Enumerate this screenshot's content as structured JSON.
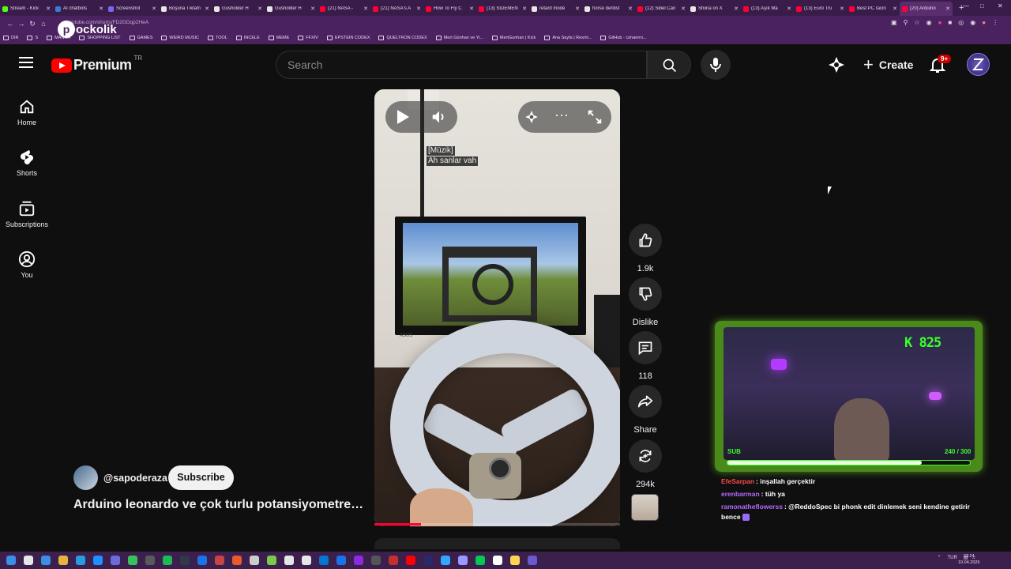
{
  "browser": {
    "tabs": [
      {
        "title": "Stream - Kick",
        "color": "#53fc18",
        "active": false
      },
      {
        "title": "AI chatbots",
        "color": "#3a7bd5",
        "active": false
      },
      {
        "title": "Screenshot",
        "color": "#7b68ee",
        "active": false
      },
      {
        "title": "Boşuna Tıklam",
        "color": "#e6e6e6",
        "active": false
      },
      {
        "title": "Gusholder H",
        "color": "#e6e6e6",
        "active": false
      },
      {
        "title": "Gusholder H",
        "color": "#e6e6e6",
        "active": false
      },
      {
        "title": "(21) NASA -",
        "color": "#ff0033",
        "active": false
      },
      {
        "title": "(21) NASA's A",
        "color": "#ff0033",
        "active": false
      },
      {
        "title": "How To Fly C",
        "color": "#ff0033",
        "active": false
      },
      {
        "title": "(13) SIDEMEN",
        "color": "#ff0033",
        "active": false
      },
      {
        "title": "retard mode",
        "color": "#e6e6e6",
        "active": false
      },
      {
        "title": "horse dentist",
        "color": "#e6e6e6",
        "active": false
      },
      {
        "title": "(12) Sibel Can",
        "color": "#ff0033",
        "active": false
      },
      {
        "title": "Shiina on X",
        "color": "#e6e6e6",
        "active": false
      },
      {
        "title": "(13) Aşık Ma",
        "color": "#ff0033",
        "active": false
      },
      {
        "title": "(13) Euro Tru",
        "color": "#ff0033",
        "active": false
      },
      {
        "title": "Best PC racin",
        "color": "#ff0033",
        "active": false
      },
      {
        "title": "(20) Arduino",
        "color": "#ff0033",
        "active": true
      }
    ],
    "new_tab": "+",
    "url": "youtube.com/shorts/FD2GDqp2HeA",
    "bookmarks": [
      "DIR",
      "S",
      "MANGA",
      "SHOPPING LIST",
      "GAMES",
      "WEIRD MUSIC",
      "TOOL",
      "INCELE",
      "MEME",
      "FFXIV",
      "EPSTEIN CODEX",
      "QUELTRON CODEX",
      "Mert Günhan ve Yi...",
      "MertGunhan | Kick",
      "Ana Sayfa | Resmi...",
      "GitHub · cohaerro..."
    ],
    "overlay_brand": "ockolik"
  },
  "header": {
    "logo_text": "Premium",
    "country_code": "TR",
    "search_placeholder": "Search",
    "create_label": "Create",
    "notification_badge": "9+"
  },
  "guide": [
    {
      "label": "Home",
      "icon": "home-icon"
    },
    {
      "label": "Shorts",
      "icon": "shorts-icon"
    },
    {
      "label": "Subscriptions",
      "icon": "subscriptions-icon"
    },
    {
      "label": "You",
      "icon": "you-icon"
    }
  ],
  "video": {
    "caption_lines": [
      "[Müzik]",
      "Ah sanlar vah"
    ],
    "monitor_brand": "ASUS",
    "progress": 0.19
  },
  "actions": {
    "like_count": "1.9k",
    "dislike_label": "Dislike",
    "comment_count": "118",
    "share_label": "Share",
    "remix_count": "294k"
  },
  "channel": {
    "handle": "@sapoderaza",
    "subscribe_label": "Subscribe",
    "title": "Arduino leonardo ve çok turlu potansiyometre ile direksiyon"
  },
  "stream_overlay": {
    "follower_count": "825",
    "sub_label": "SUB",
    "sub_goal_text": "240 / 300",
    "sub_progress": 0.8,
    "accent": "#3cff2a",
    "chat": [
      {
        "user": "EfeSarpan",
        "user_color": "#ff4b4b",
        "message": "inşallah gerçektir"
      },
      {
        "user": "erenbarman",
        "user_color": "#b36bff",
        "message": "tüh ya"
      },
      {
        "user": "ramonatheflowerss",
        "user_color": "#b36bff",
        "message": "@ReddoSpec bi phonk edit dinlemek seni kendine getirir bence"
      }
    ]
  },
  "taskbar": {
    "language": "TUR",
    "time": "23:24",
    "date": "10.04.2026"
  }
}
